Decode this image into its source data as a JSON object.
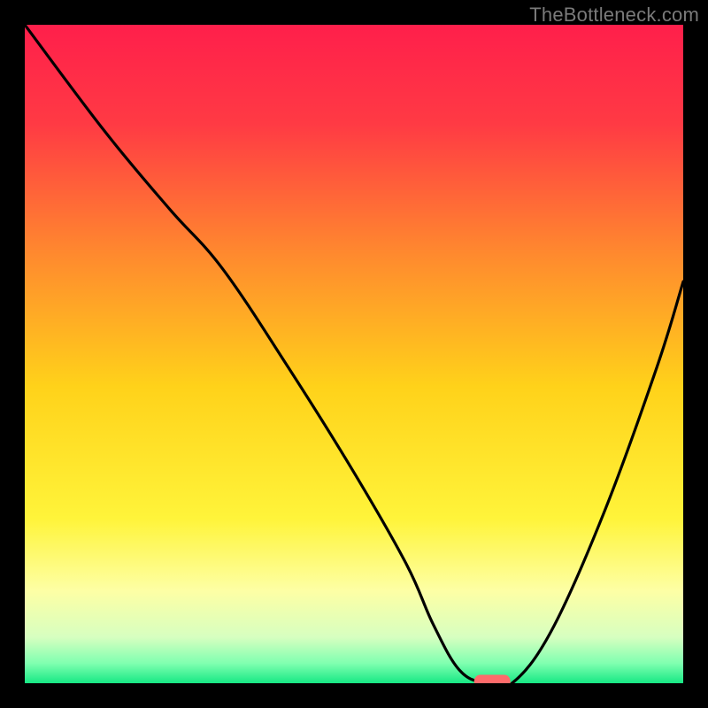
{
  "watermark": "TheBottleneck.com",
  "chart_data": {
    "type": "line",
    "title": "",
    "xlabel": "",
    "ylabel": "",
    "xlim": [
      0,
      100
    ],
    "ylim": [
      0,
      100
    ],
    "background_gradient": {
      "stops": [
        {
          "offset": 0,
          "color": "#ff1f4b"
        },
        {
          "offset": 0.15,
          "color": "#ff3a44"
        },
        {
          "offset": 0.35,
          "color": "#ff8a2e"
        },
        {
          "offset": 0.55,
          "color": "#ffd21a"
        },
        {
          "offset": 0.75,
          "color": "#fff43a"
        },
        {
          "offset": 0.86,
          "color": "#fdffa5"
        },
        {
          "offset": 0.93,
          "color": "#d7ffc0"
        },
        {
          "offset": 0.97,
          "color": "#7fffb0"
        },
        {
          "offset": 1.0,
          "color": "#17e884"
        }
      ]
    },
    "series": [
      {
        "name": "bottleneck-curve",
        "color": "#000000",
        "x": [
          0,
          12,
          22,
          30,
          40,
          50,
          58,
          62,
          66,
          70,
          74,
          80,
          88,
          96,
          100
        ],
        "y": [
          100,
          84,
          72,
          63,
          48,
          32,
          18,
          9,
          2,
          0,
          0,
          8,
          26,
          48,
          61
        ]
      }
    ],
    "marker": {
      "name": "optimal-marker",
      "color": "#ff6b6b",
      "x": 71,
      "y": 0,
      "width": 5.5,
      "height": 2.0
    }
  }
}
